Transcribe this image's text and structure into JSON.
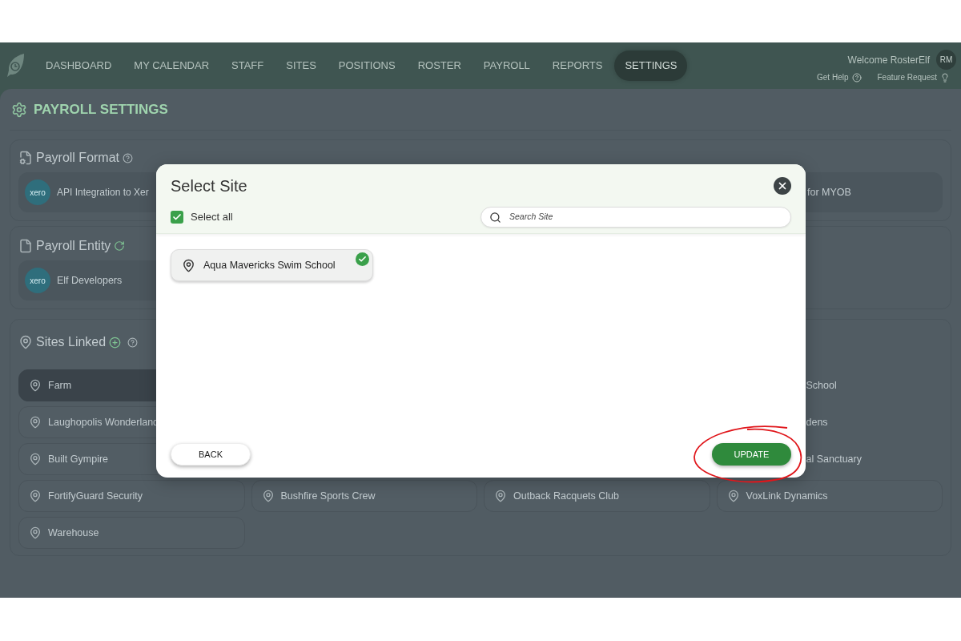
{
  "nav": {
    "items": [
      {
        "label": "DASHBOARD",
        "selected": false
      },
      {
        "label": "MY CALENDAR",
        "selected": false
      },
      {
        "label": "STAFF",
        "selected": false
      },
      {
        "label": "SITES",
        "selected": false
      },
      {
        "label": "POSITIONS",
        "selected": false
      },
      {
        "label": "ROSTER",
        "selected": false
      },
      {
        "label": "PAYROLL",
        "selected": false
      },
      {
        "label": "REPORTS",
        "selected": false
      },
      {
        "label": "SETTINGS",
        "selected": true
      }
    ],
    "welcome": "Welcome RosterElf",
    "avatar": "RM",
    "help": "Get Help",
    "feature_request": "Feature Request"
  },
  "page_title": "PAYROLL SETTINGS",
  "payroll_format": {
    "title": "Payroll Format",
    "options": [
      {
        "logo": "xero",
        "label": "API Integration to Xer",
        "kind": "full"
      },
      {
        "label": "for MYOB",
        "kind": "clipped"
      }
    ]
  },
  "payroll_entity": {
    "title": "Payroll Entity",
    "logo": "xero",
    "entity": "Elf Developers"
  },
  "sites_linked": {
    "title": "Sites Linked",
    "rows": [
      {
        "cells": [
          {
            "kind": "full",
            "name": "Farm",
            "selected": true
          },
          {
            "kind": "covered"
          },
          {
            "kind": "covered"
          },
          {
            "kind": "clipped",
            "name": "School"
          }
        ]
      },
      {
        "cells": [
          {
            "kind": "full",
            "name": "Laughopolis Wonderland",
            "selected": false
          },
          {
            "kind": "covered"
          },
          {
            "kind": "covered"
          },
          {
            "kind": "clipped",
            "name": "dens"
          }
        ]
      },
      {
        "cells": [
          {
            "kind": "full",
            "name": "Built Gympire",
            "selected": false
          },
          {
            "kind": "covered"
          },
          {
            "kind": "covered"
          },
          {
            "kind": "clipped",
            "name": "al Sanctuary"
          }
        ]
      },
      {
        "cells": [
          {
            "kind": "full",
            "name": "FortifyGuard Security",
            "selected": false
          },
          {
            "kind": "full",
            "name": "Bushfire Sports Crew",
            "selected": false
          },
          {
            "kind": "full",
            "name": "Outback Racquets Club",
            "selected": false
          },
          {
            "kind": "full",
            "name": "VoxLink Dynamics",
            "selected": false
          }
        ]
      },
      {
        "cells": [
          {
            "kind": "full",
            "name": "Warehouse",
            "selected": false
          }
        ]
      }
    ]
  },
  "modal": {
    "title": "Select Site",
    "select_all": {
      "label": "Select all",
      "checked": true
    },
    "search": {
      "placeholder": "Search Site"
    },
    "sites": [
      {
        "name": "Aqua Mavericks Swim School",
        "selected": true
      }
    ],
    "buttons": [
      {
        "label": "BACK",
        "kind": "secondary"
      },
      {
        "label": "UPDATE",
        "kind": "primary"
      }
    ]
  }
}
